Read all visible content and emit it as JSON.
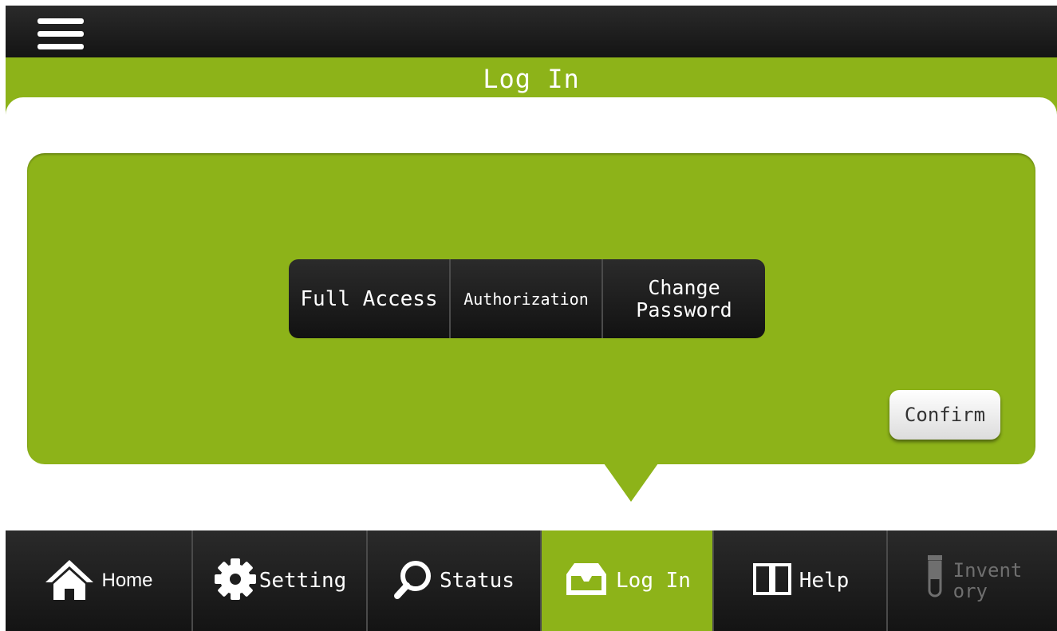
{
  "header": {
    "menu_icon": "hamburger-icon",
    "title": "Log In"
  },
  "access_levels": [
    {
      "label": "Full Access"
    },
    {
      "label": "Authorization"
    },
    {
      "label": "Change\nPassword"
    }
  ],
  "confirm_label": "Confirm",
  "tabs": [
    {
      "label": "Home",
      "icon": "home-icon"
    },
    {
      "label": "Setting",
      "icon": "gear-icon"
    },
    {
      "label": "Status",
      "icon": "search-icon"
    },
    {
      "label": "Log In",
      "icon": "inbox-icon",
      "active": true
    },
    {
      "label": "Help",
      "icon": "book-icon"
    },
    {
      "label": "Invent\nory",
      "icon": "test-tube-icon",
      "disabled": true
    }
  ],
  "colors": {
    "accent": "#8db319",
    "bar_dark": "#1a1a1a",
    "disabled_text": "#6f6f6f"
  }
}
